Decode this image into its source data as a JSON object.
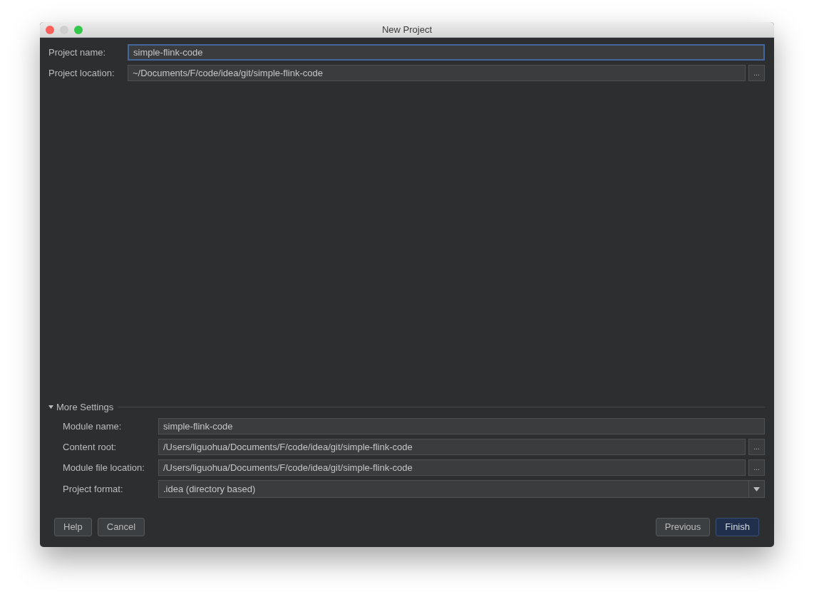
{
  "window": {
    "title": "New Project"
  },
  "fields": [
    {
      "kind": "text",
      "label": "Project name:",
      "value": "simple-flink-code",
      "focused": true
    },
    {
      "kind": "path",
      "label": "Project location:",
      "value": "~/Documents/F/code/idea/git/simple-flink-code",
      "focused": false,
      "browse_label": "..."
    }
  ],
  "more_settings": {
    "title": "More Settings",
    "expanded": true,
    "fields": [
      {
        "kind": "text",
        "label": "Module name:",
        "value": "simple-flink-code"
      },
      {
        "kind": "path",
        "label": "Content root:",
        "value": "/Users/liguohua/Documents/F/code/idea/git/simple-flink-code",
        "browse_label": "..."
      },
      {
        "kind": "path",
        "label": "Module file location:",
        "value": "/Users/liguohua/Documents/F/code/idea/git/simple-flink-code",
        "browse_label": "..."
      },
      {
        "kind": "select",
        "label": "Project format:",
        "value": ".idea (directory based)"
      }
    ]
  },
  "buttons_left": [
    {
      "label": "Help",
      "default": false
    },
    {
      "label": "Cancel",
      "default": false
    }
  ],
  "buttons_right": [
    {
      "label": "Previous",
      "default": false
    },
    {
      "label": "Finish",
      "default": true
    }
  ]
}
